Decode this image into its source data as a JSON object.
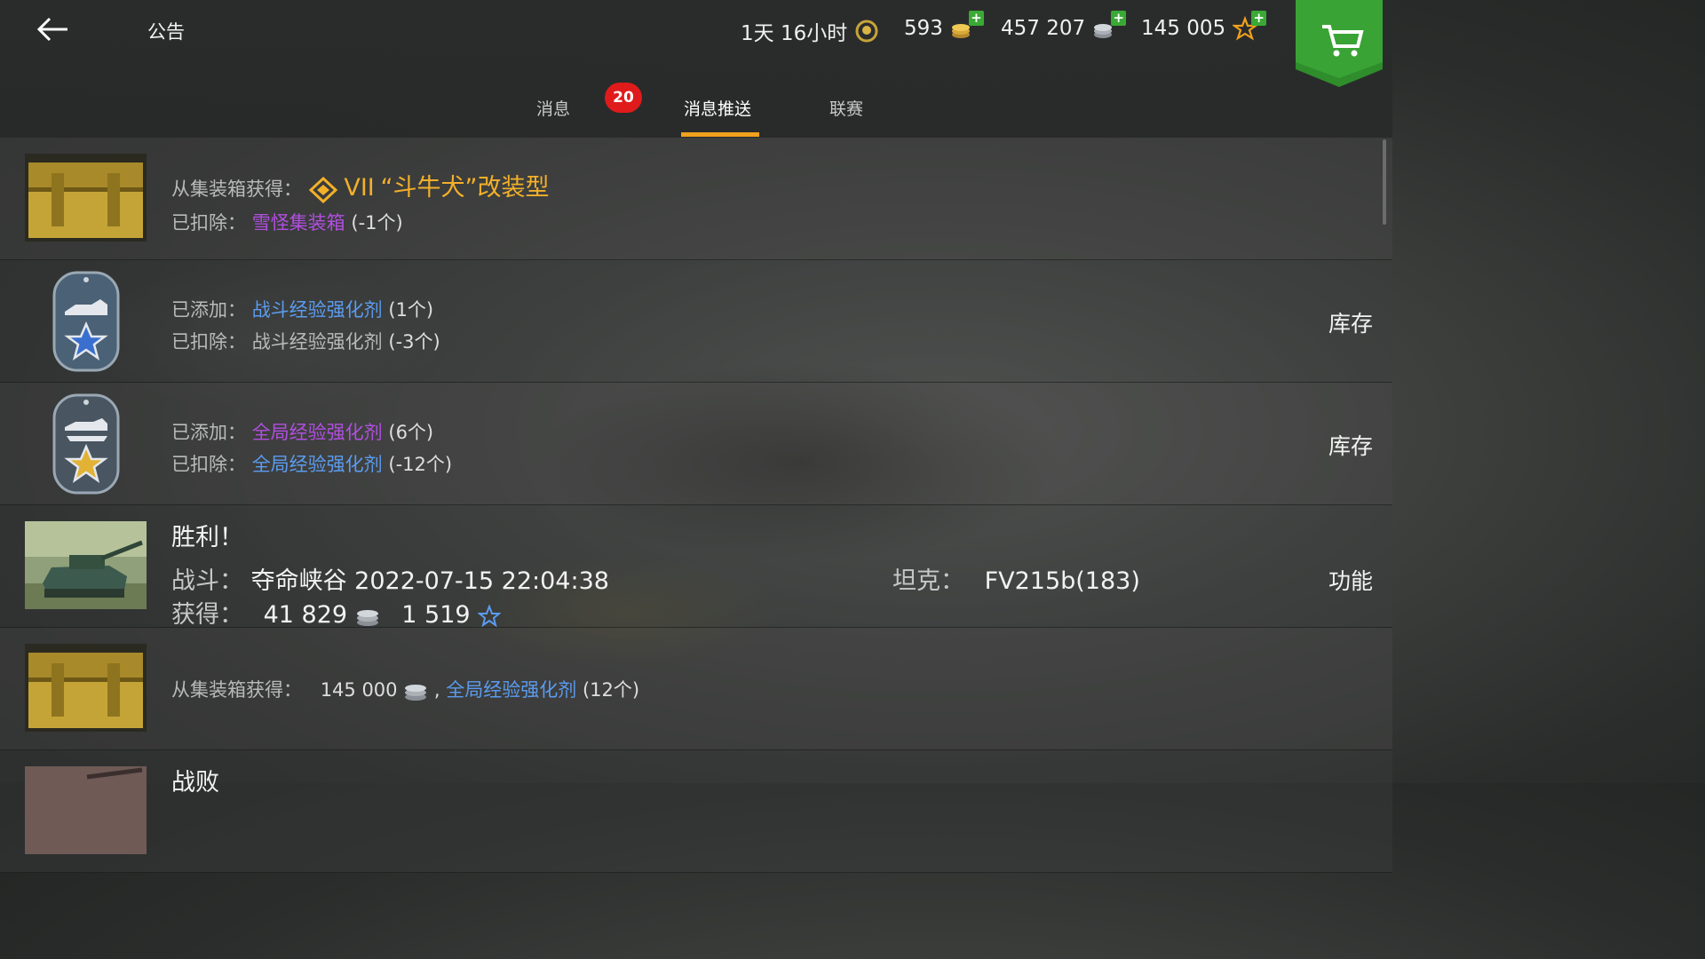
{
  "header": {
    "title": "公告",
    "premium_time": "1天 16小时",
    "gold": "593",
    "credits": "457 207",
    "free_xp": "145 005"
  },
  "tabs": [
    {
      "label": "消息",
      "badge": "20"
    },
    {
      "label": "消息推送"
    },
    {
      "label": "联赛"
    }
  ],
  "rows": [
    {
      "line1_label": "从集装箱获得：",
      "line1_tier": "VII",
      "line1_value": "“斗牛犬”改装型",
      "line2_label": "已扣除：",
      "line2_item": "雪怪集装箱",
      "line2_qty": "(-1个)"
    },
    {
      "line1_label": "已添加：",
      "line1_item": "战斗经验强化剂",
      "line1_qty": "(1个)",
      "line2_label": "已扣除：",
      "line2_item": "战斗经验强化剂",
      "line2_qty": "(-3个)",
      "action": "库存"
    },
    {
      "line1_label": "已添加：",
      "line1_item": "全局经验强化剂",
      "line1_qty": "(6个)",
      "line2_label": "已扣除：",
      "line2_item": "全局经验强化剂",
      "line2_qty": "(-12个)",
      "action": "库存"
    },
    {
      "result": "胜利！",
      "battle_label": "战斗：",
      "battle_value": "夺命峡谷 2022-07-15 22:04:38",
      "earn_label": "获得：",
      "credits": "41 829",
      "xp": "1 519",
      "tank_label": "坦克：",
      "tank_value": "FV215b(183)",
      "action": "功能"
    },
    {
      "line1_label": "从集装箱获得：",
      "credits": "145 000",
      "sep": ",",
      "item": "全局经验强化剂",
      "qty": "(12个)"
    },
    {
      "result": "战败"
    }
  ],
  "colors": {
    "tab_underline": "#f0a11d",
    "badge": "#e01b1b",
    "link_blue": "#5b9cf0",
    "link_purple": "#b14fe0",
    "gold_text": "#f2b02a",
    "shop_green": "#2f8d2c"
  }
}
